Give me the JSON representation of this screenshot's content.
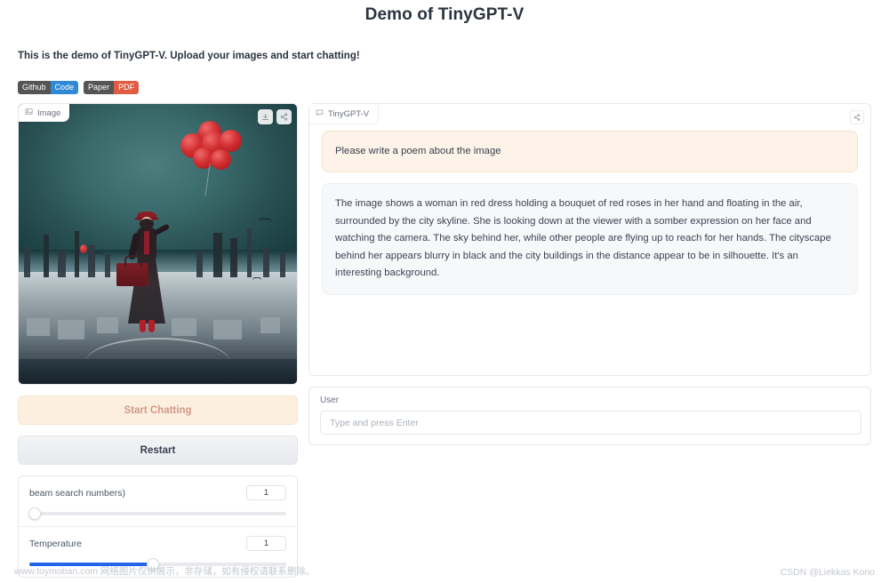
{
  "header": {
    "title": "Demo of TinyGPT-V",
    "subtitle": "This is the demo of TinyGPT-V. Upload your images and start chatting!"
  },
  "badges": [
    {
      "key": "Github",
      "value": "Code",
      "value_color": "#2e8ad6",
      "key_color": "#555555"
    },
    {
      "key": "Paper",
      "value": "PDF",
      "value_color": "#e05d44",
      "key_color": "#555555"
    }
  ],
  "image_panel": {
    "tab_label": "Image",
    "tab_icon": "image-icon",
    "download_icon": "download-icon",
    "share_icon": "share-icon",
    "alt": "Surreal photo of a woman in a red and black victorian dress floating above a grey cityscape, holding a bunch of red balloons and a red suitcase"
  },
  "buttons": {
    "start_chatting": "Start Chatting",
    "restart": "Restart"
  },
  "sliders": [
    {
      "label": "beam search numbers)",
      "value": "1",
      "fill_percent": 0,
      "thumb_percent": 2,
      "accent": "#2563eb"
    },
    {
      "label": "Temperature",
      "value": "1",
      "fill_percent": 48,
      "thumb_percent": 48,
      "accent": "#2563eb"
    }
  ],
  "chat": {
    "tab_label": "TinyGPT-V",
    "tab_icon": "chat-bubble-icon",
    "share_icon": "share-icon",
    "messages": [
      {
        "role": "user",
        "text": "Please write a poem about the image"
      },
      {
        "role": "assistant",
        "text": "The image shows a woman in red dress holding a bouquet of red roses in her hand and floating in the air, surrounded by the city skyline. She is looking down at the viewer with a somber expression on her face and watching the camera. The sky behind her, while other people are flying up to reach for her hands. The cityscape behind her appears blurry in black and the city buildings in the distance appear to be in silhouette. It's an interesting background."
      }
    ]
  },
  "input": {
    "label": "User",
    "placeholder": "Type and press Enter",
    "value": ""
  },
  "footer": {
    "left": "www.toymoban.com 网络图片仅供展示，非存储，如有侵权请联系删除。",
    "right": "CSDN @Liekkas Kono"
  }
}
